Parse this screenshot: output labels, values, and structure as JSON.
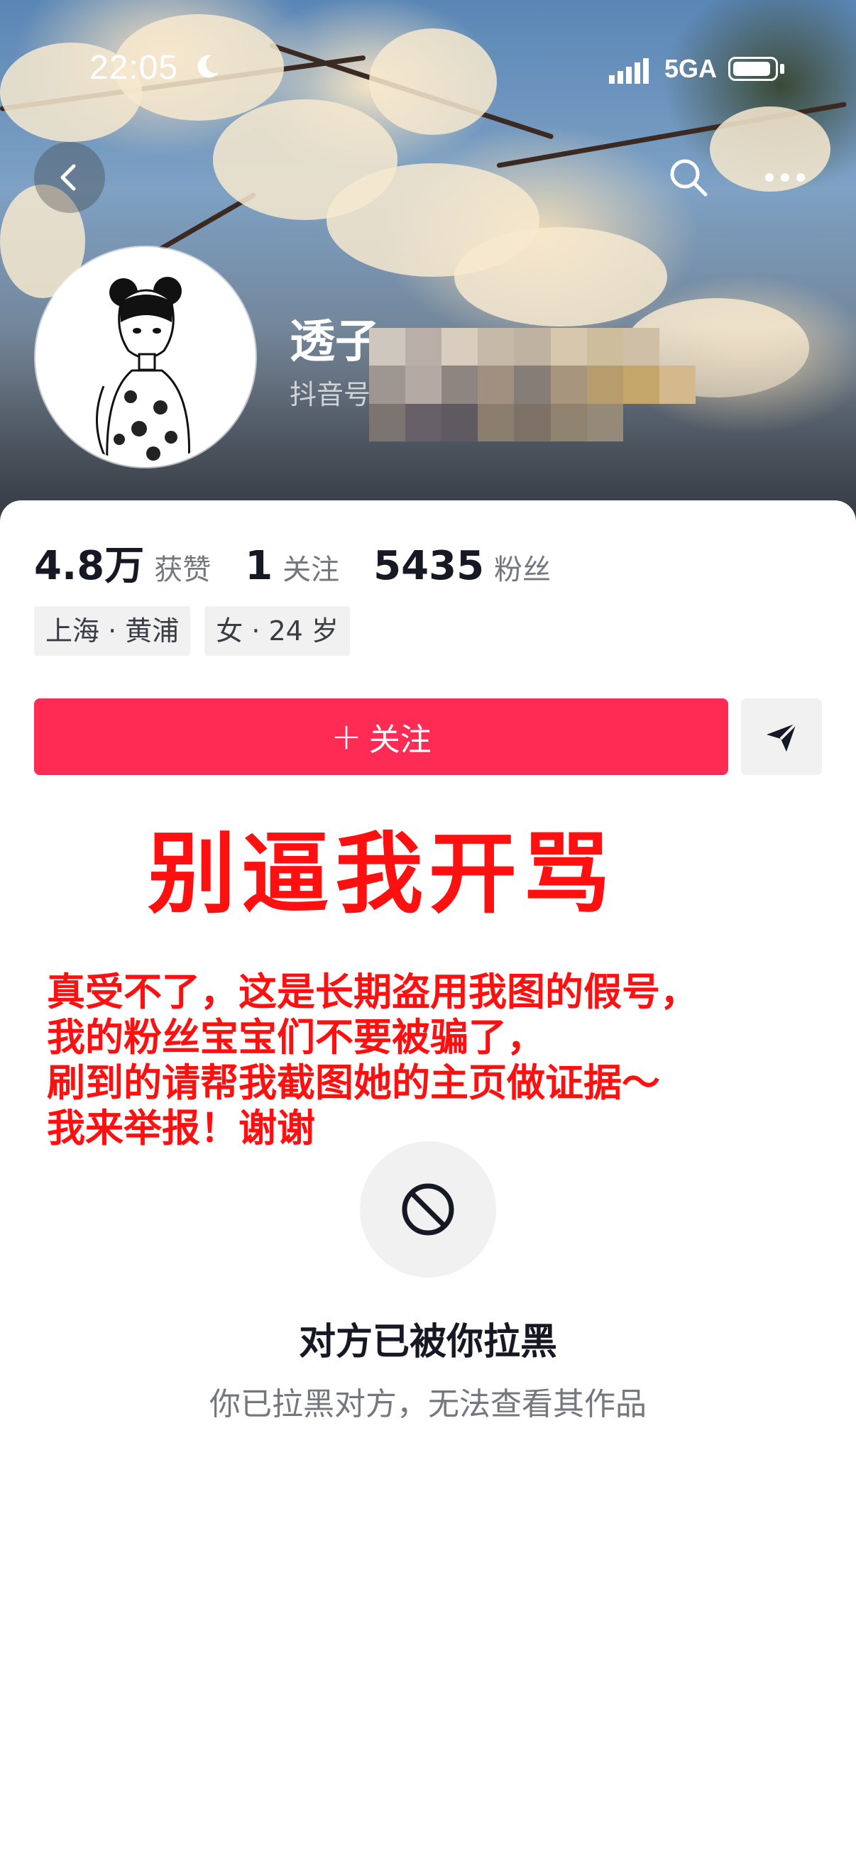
{
  "status_bar": {
    "time": "22:05",
    "network": "5GA"
  },
  "header": {
    "back_icon": "chevron-left-icon",
    "search_icon": "search-icon",
    "more_icon": "more-horizontal-icon"
  },
  "profile": {
    "name": "透子",
    "douyin_id_label": "抖音号"
  },
  "stats": [
    {
      "value": "4.8万",
      "label": "获赞"
    },
    {
      "value": "1",
      "label": "关注"
    },
    {
      "value": "5435",
      "label": "粉丝"
    }
  ],
  "tags": [
    "上海 · 黄浦",
    "女 · 24 岁"
  ],
  "actions": {
    "follow_label": "关注",
    "message_icon": "send-icon"
  },
  "overlay": {
    "title": "别逼我开骂",
    "lines": [
      "真受不了，这是长期盗用我图的假号，",
      "我的粉丝宝宝们不要被骗了，",
      "刷到的请帮我截图她的主页做证据～",
      "我来举报！谢谢"
    ]
  },
  "blocked": {
    "icon": "block-icon",
    "title": "对方已被你拉黑",
    "subtitle": "你已拉黑对方，无法查看其作品"
  },
  "colors": {
    "accent": "#fe2c55",
    "overlay_text": "#ff1010"
  }
}
